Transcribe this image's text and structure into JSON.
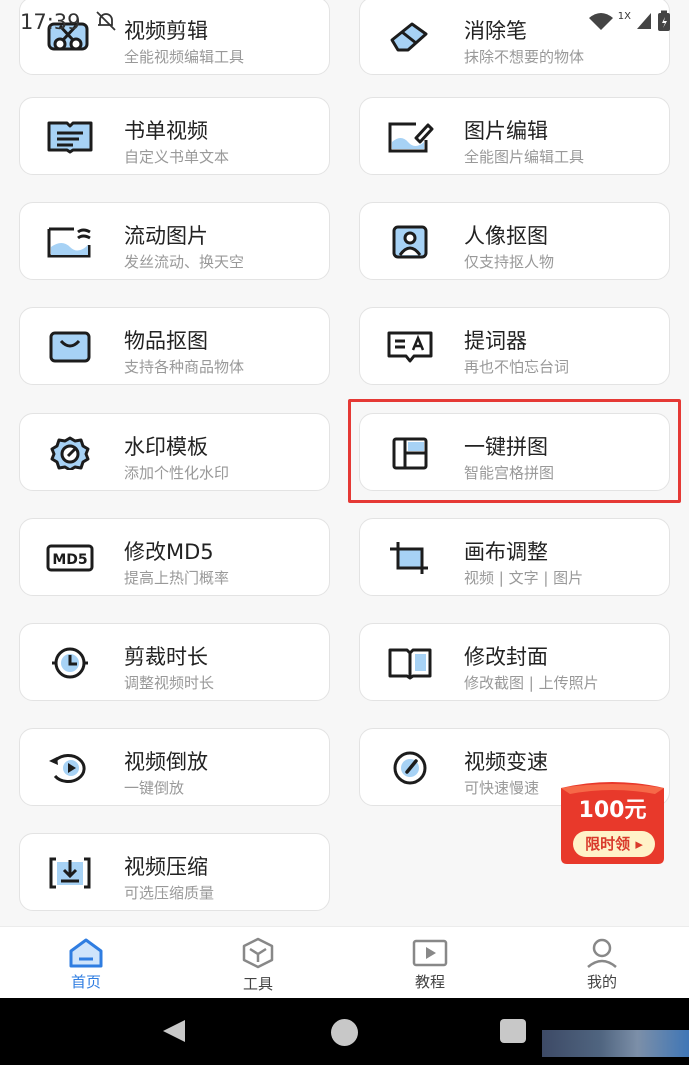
{
  "status": {
    "time": "17:39",
    "network_speed": "1X"
  },
  "cards": [
    {
      "title": "视频剪辑",
      "subtitle": "全能视频编辑工具",
      "icon": "scissors-icon"
    },
    {
      "title": "消除笔",
      "subtitle": "抹除不想要的物体",
      "icon": "eraser-icon"
    },
    {
      "title": "书单视频",
      "subtitle": "自定义书单文本",
      "icon": "book-list-icon"
    },
    {
      "title": "图片编辑",
      "subtitle": "全能图片编辑工具",
      "icon": "image-edit-icon"
    },
    {
      "title": "流动图片",
      "subtitle": "发丝流动、换天空",
      "icon": "flowing-image-icon"
    },
    {
      "title": "人像抠图",
      "subtitle": "仅支持抠人物",
      "icon": "portrait-cutout-icon"
    },
    {
      "title": "物品抠图",
      "subtitle": "支持各种商品物体",
      "icon": "shopping-bag-icon"
    },
    {
      "title": "提词器",
      "subtitle": "再也不怕忘台词",
      "icon": "teleprompter-icon"
    },
    {
      "title": "水印模板",
      "subtitle": "添加个性化水印",
      "icon": "watermark-badge-icon"
    },
    {
      "title": "一键拼图",
      "subtitle": "智能宫格拼图",
      "icon": "collage-grid-icon"
    },
    {
      "title": "修改MD5",
      "subtitle": "提高上热门概率",
      "icon": "md5-icon"
    },
    {
      "title": "画布调整",
      "subtitle": "视频 | 文字 | 图片",
      "icon": "canvas-crop-icon"
    },
    {
      "title": "剪裁时长",
      "subtitle": "调整视频时长",
      "icon": "clock-icon"
    },
    {
      "title": "修改封面",
      "subtitle": "修改截图 | 上传照片",
      "icon": "cover-book-icon"
    },
    {
      "title": "视频倒放",
      "subtitle": "一键倒放",
      "icon": "reverse-play-icon"
    },
    {
      "title": "视频变速",
      "subtitle": "可快速慢速",
      "icon": "speedometer-icon"
    },
    {
      "title": "视频压缩",
      "subtitle": "可选压缩质量",
      "icon": "compress-icon"
    }
  ],
  "promo": {
    "amount": "100元",
    "label": "限时领 ▸"
  },
  "tabs": [
    {
      "label": "首页",
      "icon": "home-icon",
      "active": true
    },
    {
      "label": "工具",
      "icon": "tools-cube-icon",
      "active": false
    },
    {
      "label": "教程",
      "icon": "tutorial-play-icon",
      "active": false
    },
    {
      "label": "我的",
      "icon": "profile-icon",
      "active": false
    }
  ],
  "colors": {
    "accent": "#2f7de1",
    "icon_fill": "#a7d2f5",
    "icon_stroke": "#1c1c1c",
    "highlight": "#e53935",
    "promo": "#e8392b"
  }
}
